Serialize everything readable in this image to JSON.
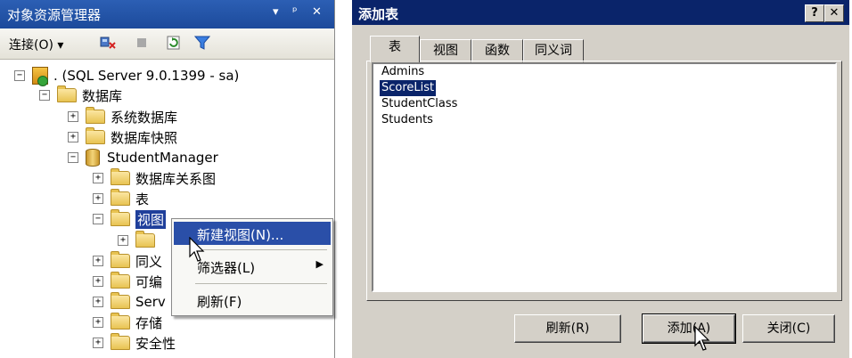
{
  "object_explorer": {
    "title": "对象资源管理器",
    "title_controls": {
      "dropdown": "▾",
      "pin": "ᵖ",
      "close": "✕"
    },
    "toolbar": {
      "connect_label": "连接(O)",
      "connect_dropdown": "▾"
    },
    "tree": [
      {
        "label": ". (SQL Server 9.0.1399 - sa)",
        "icon": "server-icon",
        "expander": "−"
      },
      {
        "label": "数据库",
        "icon": "folder-icon",
        "expander": "−"
      },
      {
        "label": "系统数据库",
        "icon": "folder-icon",
        "expander": "+"
      },
      {
        "label": "数据库快照",
        "icon": "folder-icon",
        "expander": "+"
      },
      {
        "label": "StudentManager",
        "icon": "database-icon",
        "expander": "−"
      },
      {
        "label": "数据库关系图",
        "icon": "folder-icon",
        "expander": "+"
      },
      {
        "label": "表",
        "icon": "folder-icon",
        "expander": "+"
      },
      {
        "label": "视图",
        "icon": "folder-icon",
        "expander": "−",
        "selected": true
      },
      {
        "label": "",
        "icon": "folder-icon",
        "expander": "+"
      },
      {
        "label": "同义",
        "icon": "folder-icon",
        "expander": "+"
      },
      {
        "label": "可编",
        "icon": "folder-icon",
        "expander": "+"
      },
      {
        "label": "Serv",
        "icon": "folder-icon",
        "expander": "+"
      },
      {
        "label": "存储",
        "icon": "folder-icon",
        "expander": "+"
      },
      {
        "label": "安全性",
        "icon": "folder-icon",
        "expander": "+"
      }
    ],
    "context_menu": {
      "items": [
        {
          "label": "新建视图(N)...",
          "highlighted": true
        },
        {
          "label": "筛选器(L)",
          "submenu_arrow": "▶"
        },
        {
          "label": "刷新(F)"
        }
      ]
    }
  },
  "add_table_dialog": {
    "title": "添加表",
    "caption_buttons": {
      "help": "?",
      "close": "✕"
    },
    "tabs": [
      "表",
      "视图",
      "函数",
      "同义词"
    ],
    "active_tab": "表",
    "tables": [
      "Admins",
      "ScoreList",
      "StudentClass",
      "Students"
    ],
    "selected_table": "ScoreList",
    "buttons": {
      "refresh": "刷新(R)",
      "add": "添加(A)",
      "close": "关闭(C)"
    }
  },
  "colors": {
    "oe_title_bg": "#1c4a9b",
    "dialog_title_bg": "#0a246a",
    "selection_bg": "#0a246a",
    "menu_highlight": "#2a4fa8",
    "dialog_face": "#d4d0c8"
  }
}
